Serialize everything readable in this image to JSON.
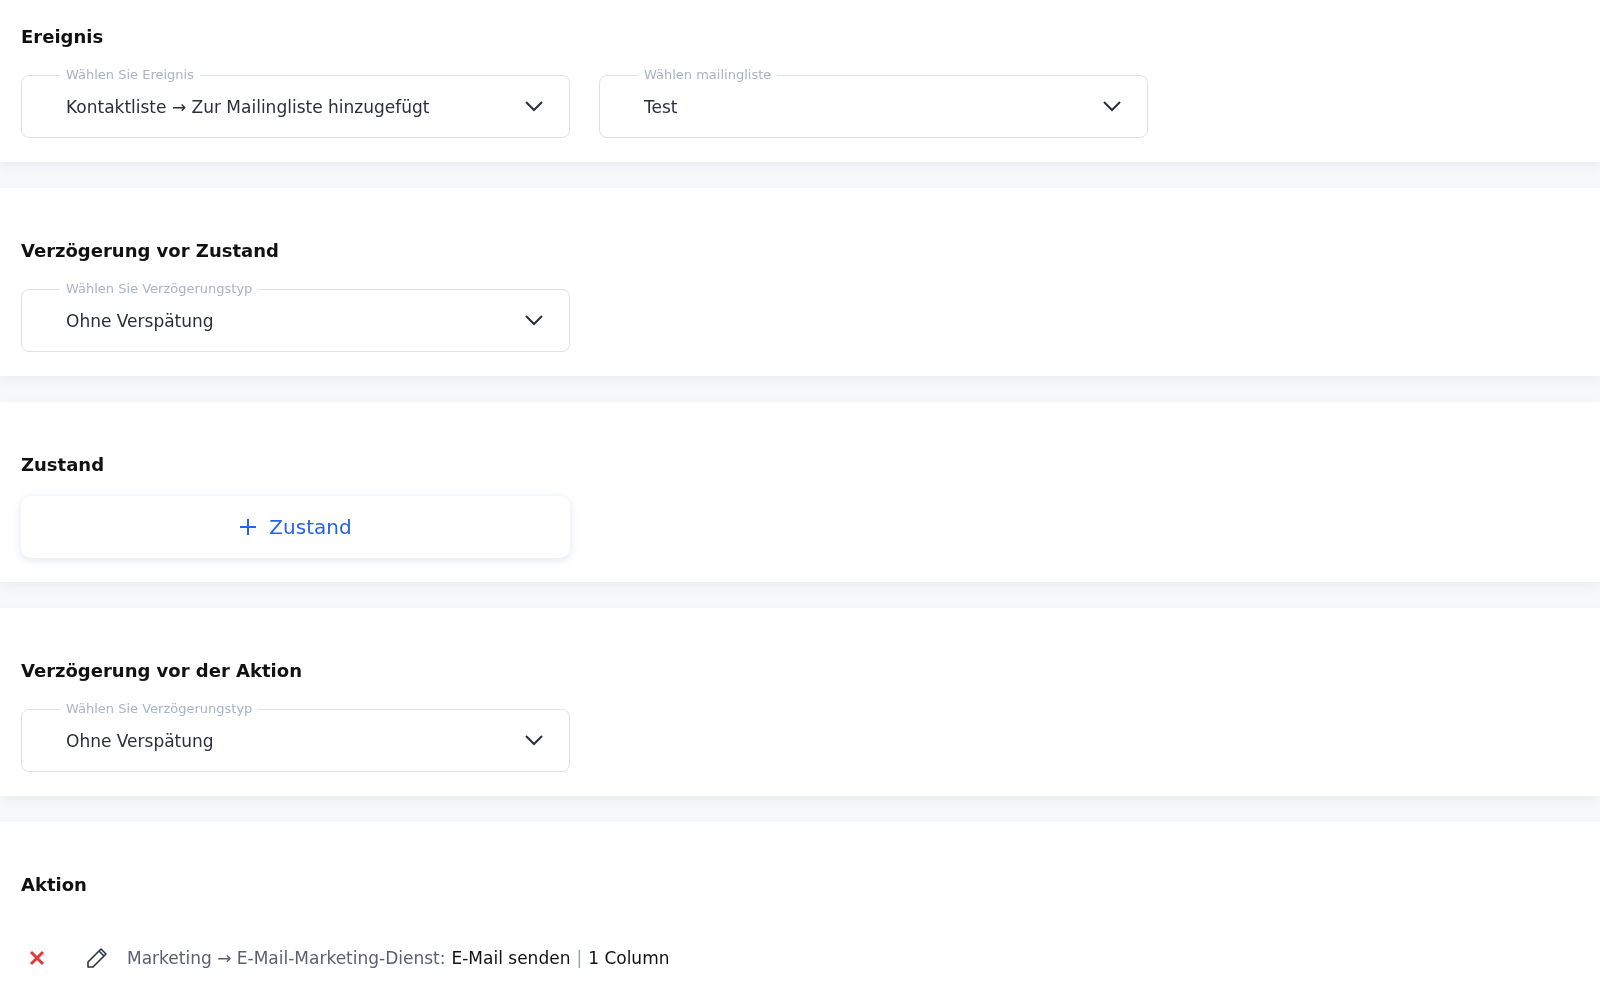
{
  "sections": [
    {
      "kind": "selects",
      "title": "Ereignis",
      "fields": [
        {
          "label": "Wählen Sie Ereignis",
          "value": "Kontaktliste → Zur Mailingliste hinzugefügt"
        },
        {
          "label": "Wählen mailingliste",
          "value": "Test"
        }
      ]
    },
    {
      "kind": "selects",
      "title": "Verzögerung vor Zustand",
      "fields": [
        {
          "label": "Wählen Sie Verzögerungstyp",
          "value": "Ohne Verspätung"
        }
      ]
    },
    {
      "kind": "add",
      "title": "Zustand",
      "button": {
        "label": "Zustand"
      }
    },
    {
      "kind": "selects",
      "title": "Verzögerung vor der Aktion",
      "fields": [
        {
          "label": "Wählen Sie Verzögerungstyp",
          "value": "Ohne Verspätung"
        }
      ]
    },
    {
      "kind": "actions",
      "title": "Aktion",
      "actions": [
        {
          "path": "Marketing → E-Mail-Marketing-Dienst:",
          "name": "E-Mail senden",
          "separator": "|",
          "detail": "1 Column"
        }
      ]
    }
  ]
}
